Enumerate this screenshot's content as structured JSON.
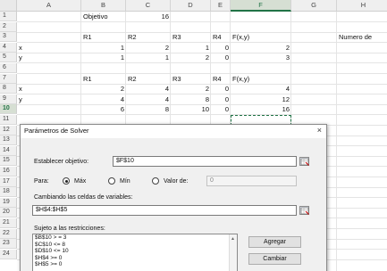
{
  "columns": [
    "A",
    "B",
    "C",
    "D",
    "E",
    "F",
    "G",
    "H"
  ],
  "selected_column": "F",
  "rows": [
    "1",
    "2",
    "3",
    "4",
    "5",
    "6",
    "7",
    "8",
    "9",
    "10",
    "11",
    "12",
    "13",
    "14",
    "15",
    "16",
    "17",
    "18",
    "19",
    "20",
    "21",
    "22",
    "23",
    "24"
  ],
  "selected_row": "10",
  "cells": {
    "B1": "Objetivo",
    "C1": "16",
    "B3": "R1",
    "C3": "R2",
    "D3": "R3",
    "E3": "R4",
    "F3": "F(x,y)",
    "H3": "Numero de",
    "A4": "x",
    "B4": "1",
    "C4": "2",
    "D4": "1",
    "E4": "0",
    "F4": "2",
    "A5": "y",
    "B5": "1",
    "C5": "1",
    "D5": "2",
    "E5": "0",
    "F5": "3",
    "B7": "R1",
    "C7": "R2",
    "D7": "R3",
    "E7": "R4",
    "F7": "F(x,y)",
    "A8": "x",
    "B8": "2",
    "C8": "4",
    "D8": "2",
    "E8": "0",
    "F8": "4",
    "A9": "y",
    "B9": "4",
    "C9": "4",
    "D9": "8",
    "E9": "0",
    "F9": "12",
    "B10": "6",
    "C10": "8",
    "D10": "10",
    "E10": "0",
    "F10": "16"
  },
  "dialog": {
    "title": "Parámetros de Solver",
    "close": "×",
    "objective_label": "Establecer objetivo:",
    "objective_value": "$F$10",
    "to_label": "Para:",
    "opt_max": "Máx",
    "opt_min": "Mín",
    "opt_value": "Valor de:",
    "value_of_input": "0",
    "selected_option": "max",
    "changing_label": "Cambiando las celdas de variables:",
    "changing_value": "$H$4:$H$5",
    "subject_label": "Sujeto a las restricciones:",
    "constraints": [
      "$B$10 > = 3",
      "$C$10 <= 8",
      "$D$10 <= 10",
      "$H$4 >= 0",
      "$H$5 >= 0"
    ],
    "add_button": "Agregar",
    "change_button": "Cambiar"
  }
}
